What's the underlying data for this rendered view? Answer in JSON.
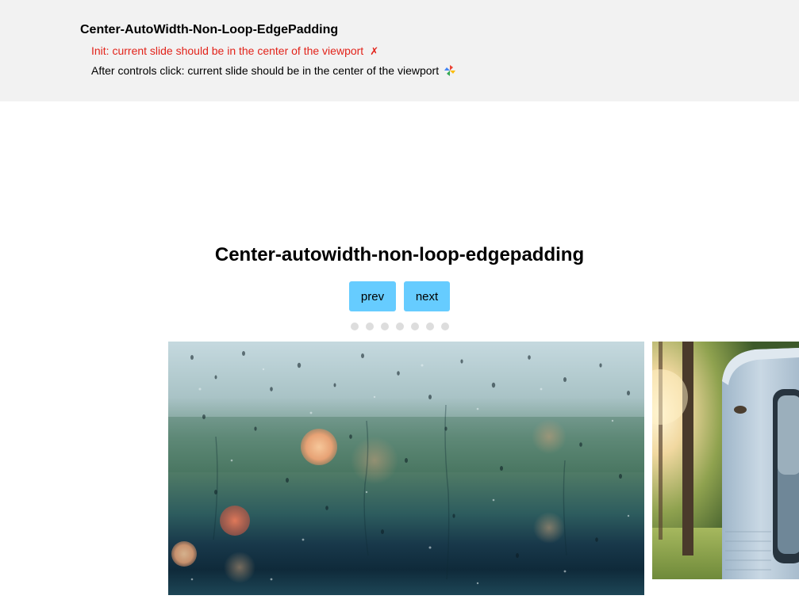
{
  "test_panel": {
    "title": "Center-AutoWidth-Non-Loop-EdgePadding",
    "results": [
      {
        "text": "Init: current slide should be in the center of the viewport",
        "status": "fail",
        "status_icon": "cross-mark-icon"
      },
      {
        "text": "After controls click: current slide should be in the center of the viewport",
        "status": "pending",
        "status_icon": "spinner-icon"
      }
    ]
  },
  "slider": {
    "heading": "Center-autowidth-non-loop-edgepadding",
    "controls": {
      "prev_label": "prev",
      "next_label": "next"
    },
    "dots_count": 7,
    "colors": {
      "button": "#66ccff",
      "dot": "#dddddd",
      "fail_text": "#e2231a",
      "panel_bg": "#f2f2f2"
    },
    "slides": [
      {
        "icon": "rainy-window-photo"
      },
      {
        "icon": "camper-van-forest-photo"
      }
    ]
  }
}
